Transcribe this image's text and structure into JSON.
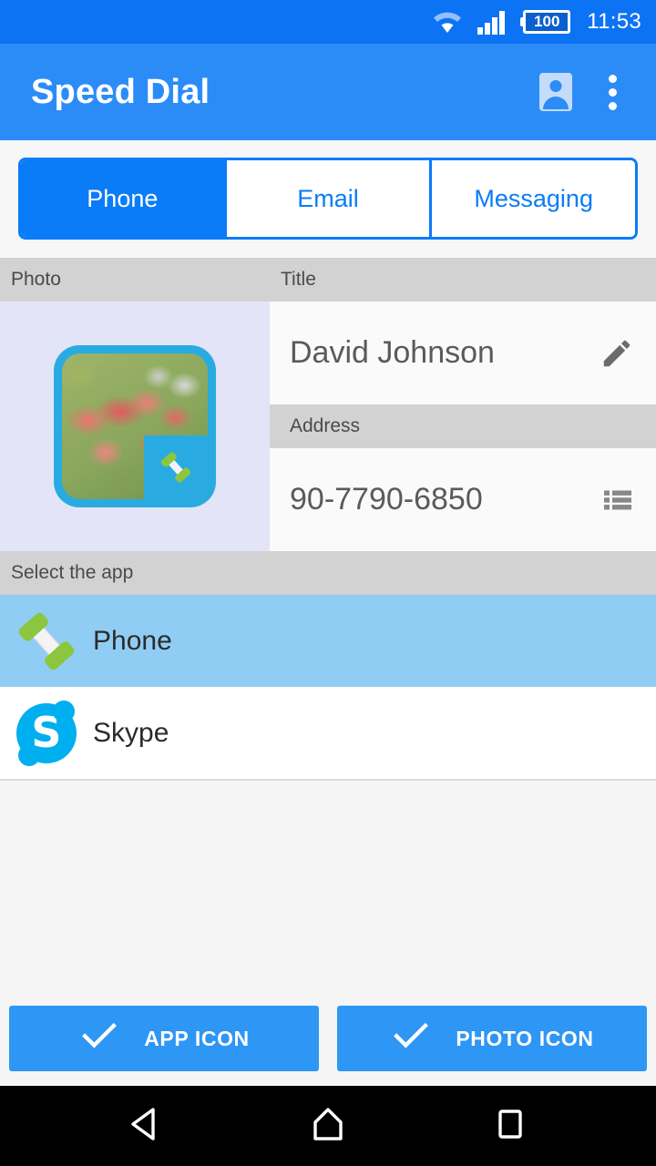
{
  "status_bar": {
    "wifi_icon": "wifi-icon",
    "signal_icon": "signal-bars-icon",
    "battery_level": "100",
    "time": "11:53"
  },
  "app_bar": {
    "title": "Speed Dial",
    "contacts_icon": "contact-card-icon",
    "overflow_icon": "more-vertical-icon"
  },
  "tabs": [
    {
      "label": "Phone",
      "active": true
    },
    {
      "label": "Email",
      "active": false
    },
    {
      "label": "Messaging",
      "active": false
    }
  ],
  "contact": {
    "photo_header": "Photo",
    "title_header": "Title",
    "title_value": "David Johnson",
    "edit_icon": "pencil-icon",
    "address_header": "Address",
    "address_value": "90-7790-6850",
    "contacts_picker_icon": "list-icon",
    "photo_badge_icon": "phone-handset-icon"
  },
  "app_picker": {
    "header": "Select the app",
    "items": [
      {
        "label": "Phone",
        "icon": "phone-handset-icon",
        "selected": true
      },
      {
        "label": "Skype",
        "icon": "skype-icon",
        "selected": false
      }
    ]
  },
  "footer_buttons": [
    {
      "label": "APP ICON",
      "icon": "check-icon"
    },
    {
      "label": "PHOTO ICON",
      "icon": "check-icon"
    }
  ],
  "nav_bar": {
    "back": "back-triangle-icon",
    "home": "home-icon",
    "recents": "recents-square-icon"
  },
  "colors": {
    "status_bar": "#0d73f5",
    "app_bar": "#2c8cf7",
    "accent": "#0a7cf7",
    "selected_row": "#90cdf4",
    "header_gray": "#d2d2d2",
    "photo_cell": "#e3e4f7",
    "button_blue": "#2e96f5"
  }
}
